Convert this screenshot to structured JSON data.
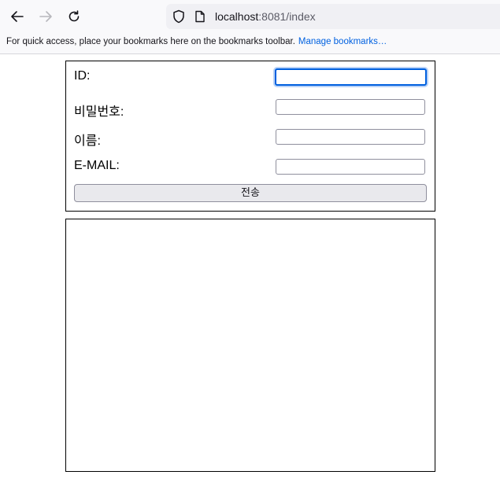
{
  "browser": {
    "url_host": "localhost",
    "url_path": ":8081/index",
    "bookmarks_message": "For quick access, place your bookmarks here on the bookmarks toolbar.",
    "manage_bookmarks": "Manage bookmarks…"
  },
  "form": {
    "id_label": "ID:",
    "password_label": "비밀번호:",
    "name_label": "이름:",
    "email_label": "E-MAIL:",
    "id_value": "",
    "password_value": "",
    "name_value": "",
    "email_value": "",
    "submit_label": "전송"
  },
  "colors": {
    "focus_ring": "#0060df",
    "link": "#0061e0",
    "button_bg": "#e9e9ed"
  }
}
